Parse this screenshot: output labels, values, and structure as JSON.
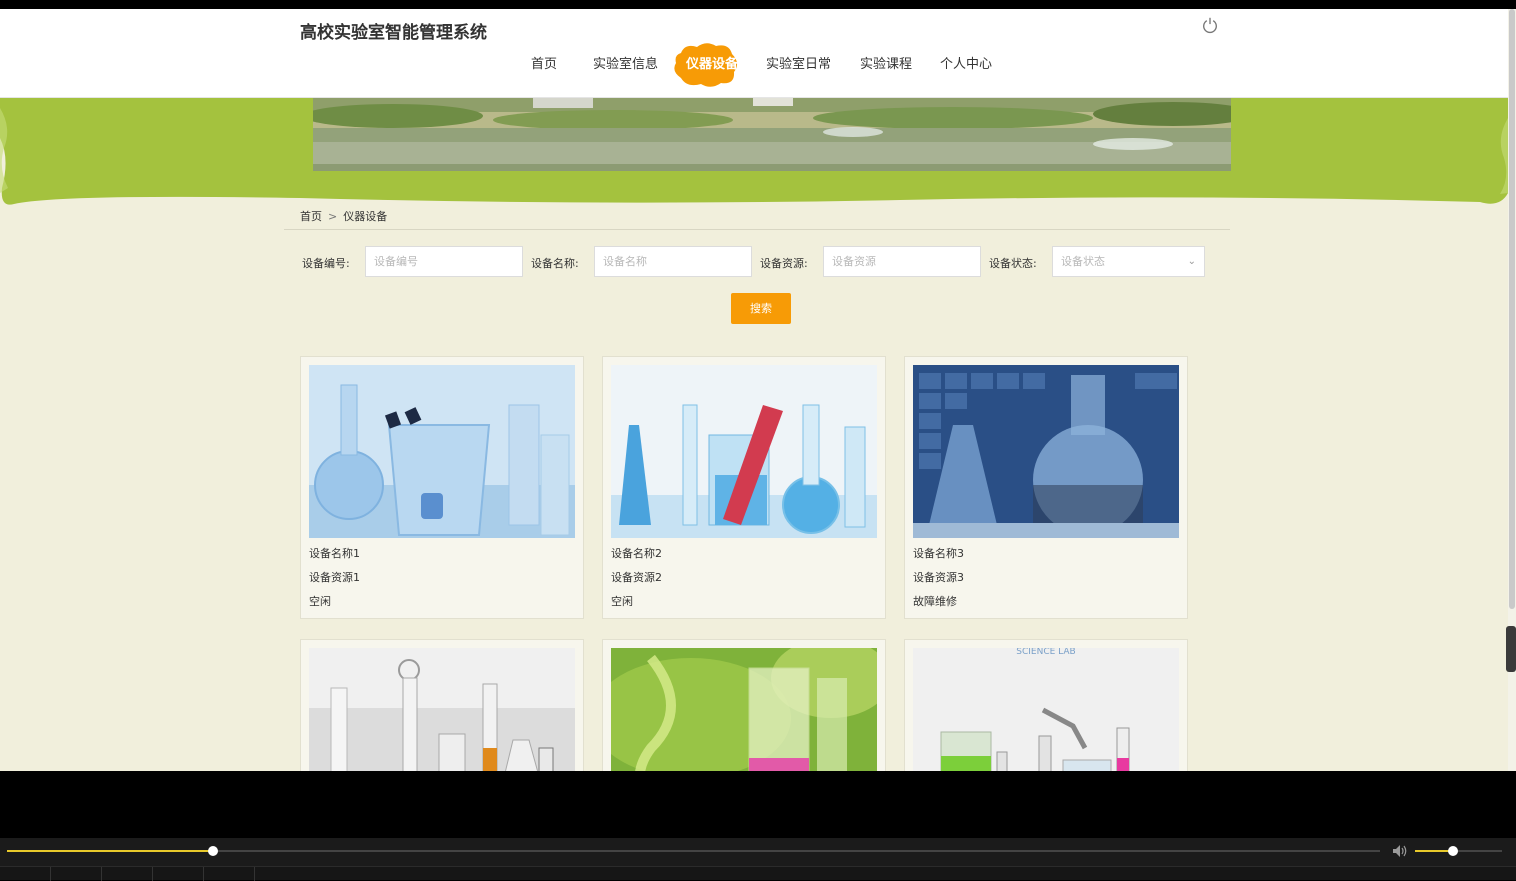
{
  "header": {
    "site_title": "高校实验室智能管理系统",
    "nav": [
      {
        "label": "首页",
        "active": false
      },
      {
        "label": "实验室信息",
        "active": false
      },
      {
        "label": "仪器设备",
        "active": true
      },
      {
        "label": "实验室日常",
        "active": false
      },
      {
        "label": "实验课程",
        "active": false
      },
      {
        "label": "个人中心",
        "active": false
      }
    ]
  },
  "breadcrumb": {
    "home": "首页",
    "separator": ">",
    "current": "仪器设备"
  },
  "search": {
    "fields": [
      {
        "label": "设备编号:",
        "placeholder": "设备编号",
        "value": ""
      },
      {
        "label": "设备名称:",
        "placeholder": "设备名称",
        "value": ""
      },
      {
        "label": "设备资源:",
        "placeholder": "设备资源",
        "value": ""
      },
      {
        "label": "设备状态:",
        "placeholder": "设备状态",
        "value": ""
      }
    ],
    "button_label": "搜索"
  },
  "cards": [
    {
      "name": "设备名称1",
      "resource": "设备资源1",
      "status": "空闲",
      "image": "glassware-blue-flasks"
    },
    {
      "name": "设备名称2",
      "resource": "设备资源2",
      "status": "空闲",
      "image": "glassware-red-test-tube"
    },
    {
      "name": "设备名称3",
      "resource": "设备资源3",
      "status": "故障维修",
      "image": "glassware-round-flask-periodic-table"
    },
    {
      "name": "",
      "resource": "",
      "status": "",
      "image": "glassware-grey-orange-cylinder"
    },
    {
      "name": "",
      "resource": "",
      "status": "",
      "image": "glassware-green-pink-beaker"
    },
    {
      "name": "",
      "resource": "",
      "status": "",
      "image": "science-lab-illustration"
    }
  ],
  "card_image_text": {
    "science_lab": "SCIENCE LAB"
  },
  "player": {
    "progress": 0.15,
    "volume": 0.44
  },
  "colors": {
    "accent": "#f79b06",
    "banner_green": "#a4c23e",
    "page_bg": "#f1efdc"
  }
}
